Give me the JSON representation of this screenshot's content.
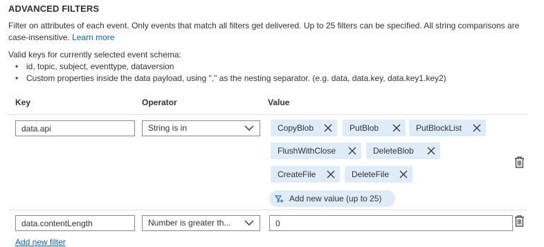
{
  "section": {
    "title": "ADVANCED FILTERS",
    "description": "Filter on attributes of each event. Only events that match all filters get delivered. Up to 25 filters can be specified. All string comparisons are case-insensitive.",
    "learn_more": "Learn more",
    "keys_intro": "Valid keys for currently selected event schema:",
    "keys_bullets": [
      "id, topic, subject, eventtype, dataversion",
      "Custom properties inside the data payload, using \".\" as the nesting separator. (e.g. data, data.key, data.key1.key2)"
    ]
  },
  "columns": {
    "key": "Key",
    "operator": "Operator",
    "value": "Value"
  },
  "filters": [
    {
      "key": "data.api",
      "operator": "String is in",
      "values": [
        "CopyBlob",
        "PutBlob",
        "PutBlockList",
        "FlushWithClose",
        "DeleteBlob",
        "CreateFile",
        "DeleteFile"
      ],
      "add_value_label": "Add new value (up to 25)"
    },
    {
      "key": "data.contentLength",
      "operator": "Number is greater th...",
      "value": "0"
    }
  ],
  "add_filter_label": "Add new filter",
  "icons": {
    "remove": "close-icon",
    "delete": "trash-icon",
    "dropdown": "chevron-down-icon",
    "add_value": "filter-plus-icon"
  },
  "colors": {
    "chip_bg": "#deecf9",
    "link": "#0066b8",
    "border": "#8a8886"
  }
}
